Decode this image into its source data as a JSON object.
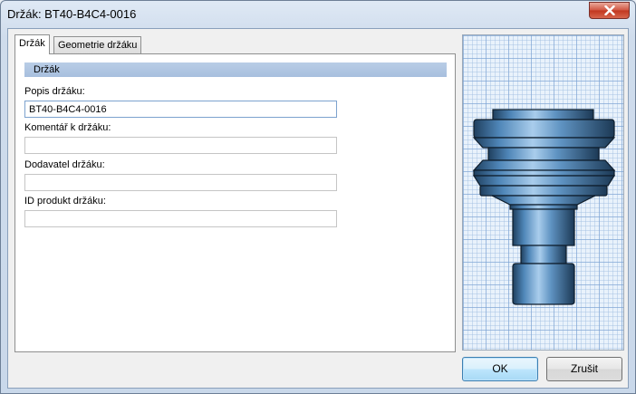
{
  "window": {
    "title": "Držák: BT40-B4C4-0016"
  },
  "tabs": [
    {
      "label": "Držák",
      "active": true
    },
    {
      "label": "Geometrie držáku",
      "active": false
    }
  ],
  "section": {
    "header": "Držák"
  },
  "fields": {
    "description": {
      "label": "Popis držáku:",
      "value": "BT40-B4C4-0016"
    },
    "comment": {
      "label": "Komentář k držáku:",
      "value": ""
    },
    "supplier": {
      "label": "Dodavatel držáku:",
      "value": ""
    },
    "product_id": {
      "label": "ID produkt držáku:",
      "value": ""
    }
  },
  "buttons": {
    "ok": "OK",
    "cancel": "Zrušit"
  },
  "colors": {
    "holder_body": "#4a7fae",
    "grid": "#78a0d2",
    "close_button": "#c1361f"
  },
  "icons": {
    "close": "close-icon"
  }
}
